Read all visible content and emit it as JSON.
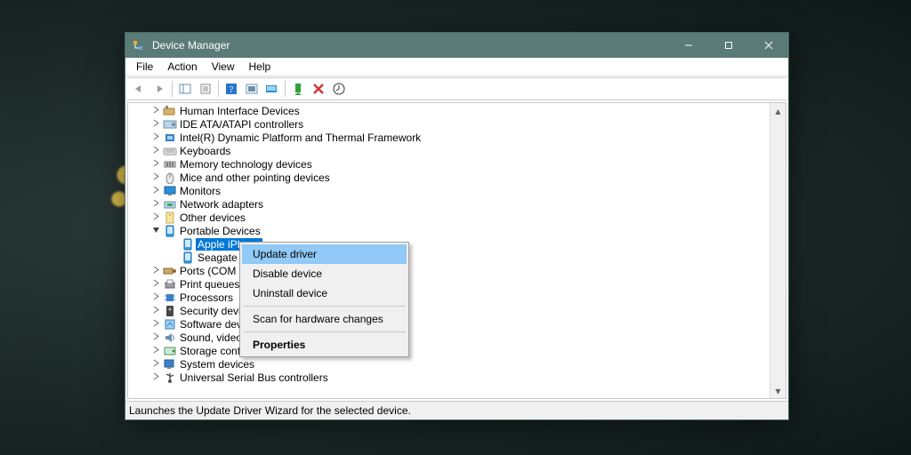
{
  "window": {
    "title": "Device Manager"
  },
  "menus": [
    "File",
    "Action",
    "View",
    "Help"
  ],
  "toolbar_icons": [
    "nav-back-icon",
    "nav-forward-icon",
    "sep",
    "show-hide-tree-icon",
    "properties-icon",
    "sep",
    "help-icon",
    "sep",
    "scan-hardware-icon",
    "show-hidden-icon",
    "sep",
    "enable-device-icon",
    "disable-device-icon",
    "update-driver-icon"
  ],
  "tree": [
    {
      "depth": 1,
      "expand": ">",
      "icon": "hid",
      "label": "Human Interface Devices"
    },
    {
      "depth": 1,
      "expand": ">",
      "icon": "ide",
      "label": "IDE ATA/ATAPI controllers"
    },
    {
      "depth": 1,
      "expand": ">",
      "icon": "chip",
      "label": "Intel(R) Dynamic Platform and Thermal Framework"
    },
    {
      "depth": 1,
      "expand": ">",
      "icon": "keyboard",
      "label": "Keyboards"
    },
    {
      "depth": 1,
      "expand": ">",
      "icon": "mem",
      "label": "Memory technology devices"
    },
    {
      "depth": 1,
      "expand": ">",
      "icon": "mouse",
      "label": "Mice and other pointing devices"
    },
    {
      "depth": 1,
      "expand": ">",
      "icon": "monitor",
      "label": "Monitors"
    },
    {
      "depth": 1,
      "expand": ">",
      "icon": "net",
      "label": "Network adapters"
    },
    {
      "depth": 1,
      "expand": ">",
      "icon": "other",
      "label": "Other devices"
    },
    {
      "depth": 1,
      "expand": "v",
      "icon": "portable",
      "label": "Portable Devices"
    },
    {
      "depth": 2,
      "icon": "portable",
      "label": "Apple iPhone",
      "selected": true
    },
    {
      "depth": 2,
      "icon": "portable",
      "label": "Seagate Expansion Drive",
      "truncated_to": "Seagate E"
    },
    {
      "depth": 1,
      "expand": ">",
      "icon": "ports",
      "label": "Ports (COM & LPT)",
      "truncated_to": "Ports (COM &"
    },
    {
      "depth": 1,
      "expand": ">",
      "icon": "printer",
      "label": "Print queues"
    },
    {
      "depth": 1,
      "expand": ">",
      "icon": "cpu",
      "label": "Processors"
    },
    {
      "depth": 1,
      "expand": ">",
      "icon": "security",
      "label": "Security devices",
      "truncated_to": "Security devic"
    },
    {
      "depth": 1,
      "expand": ">",
      "icon": "soft",
      "label": "Software devices",
      "truncated_to": "Software devi"
    },
    {
      "depth": 1,
      "expand": ">",
      "icon": "sound",
      "label": "Sound, video and game controllers",
      "truncated_to": "Sound, video"
    },
    {
      "depth": 1,
      "expand": ">",
      "icon": "storage",
      "label": "Storage controllers"
    },
    {
      "depth": 1,
      "expand": ">",
      "icon": "system",
      "label": "System devices"
    },
    {
      "depth": 1,
      "expand": ">",
      "icon": "usb",
      "label": "Universal Serial Bus controllers"
    }
  ],
  "context_menu": {
    "items": [
      {
        "label": "Update driver",
        "hover": true
      },
      {
        "label": "Disable device"
      },
      {
        "label": "Uninstall device"
      },
      {
        "sep": true
      },
      {
        "label": "Scan for hardware changes"
      },
      {
        "sep": true
      },
      {
        "label": "Properties",
        "bold": true
      }
    ]
  },
  "status": "Launches the Update Driver Wizard for the selected device.",
  "colors": {
    "titlebar": "#5a7b78",
    "selection": "#0078d7",
    "menu_hover": "#91c9f7"
  }
}
